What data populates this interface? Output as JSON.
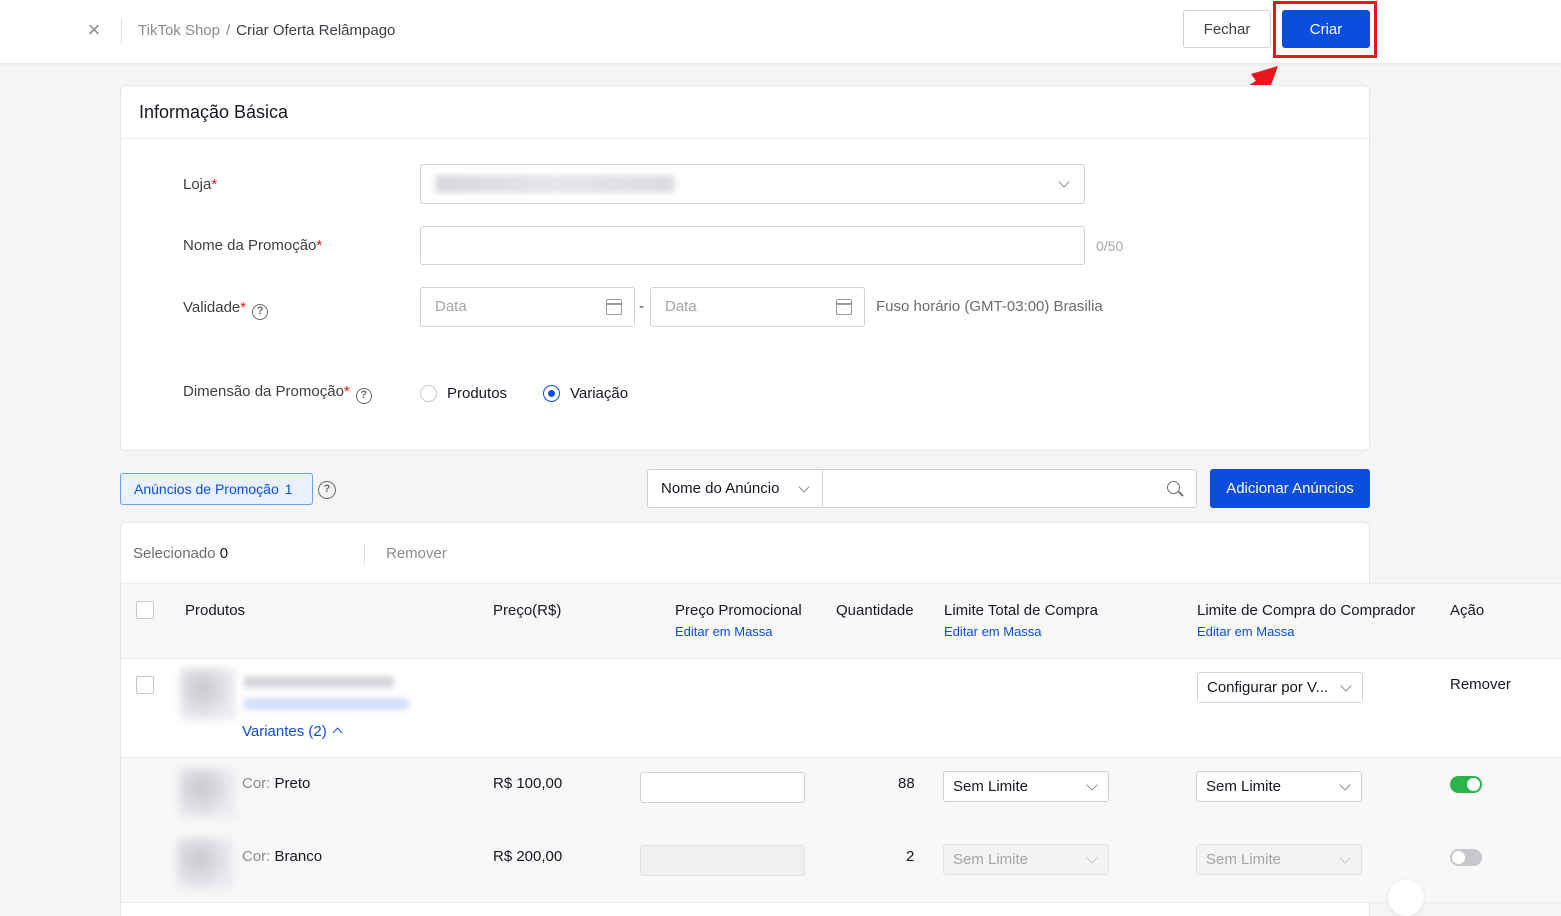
{
  "header": {
    "breadcrumb_root": "TikTok Shop",
    "breadcrumb_sep": "/",
    "breadcrumb_current": "Criar Oferta Relâmpago",
    "close_label": "Fechar",
    "create_label": "Criar"
  },
  "basic_info": {
    "title": "Informação Básica",
    "store_label": "Loja",
    "promo_name_label": "Nome da Promoção",
    "promo_name_counter": "0/50",
    "validity_label": "Validade",
    "date_start_placeholder": "Data",
    "date_sep": "-",
    "date_end_placeholder": "Data",
    "timezone": "Fuso horário (GMT-03:00) Brasilia",
    "dimension_label": "Dimensão da Promoção",
    "dimension_options": [
      "Produtos",
      "Variação"
    ],
    "dimension_selected": "Variação",
    "required_mark": "*",
    "help_mark": "?"
  },
  "listings": {
    "tab_label": "Anúncios de Promoção",
    "tab_count": "1",
    "search_field_select": "Nome do Anúncio",
    "add_button": "Adicionar Anúncios"
  },
  "table": {
    "selected_label": "Selecionado",
    "selected_count": "0",
    "remove_label": "Remover",
    "columns": {
      "products": "Produtos",
      "price": "Preço(R$)",
      "promo_price": "Preço Promocional",
      "promo_price_edit": "Editar em Massa",
      "quantity": "Quantidade",
      "total_limit": "Limite Total de Compra",
      "total_limit_edit": "Editar em Massa",
      "buyer_limit": "Limite de Compra do Comprador",
      "buyer_limit_edit": "Editar em Massa",
      "action": "Ação"
    },
    "product": {
      "variants_link": "Variantes (2)",
      "buyer_limit_select": "Configurar por V...",
      "action": "Remover"
    },
    "variants": [
      {
        "attr_key": "Cor:",
        "attr_value": "Preto",
        "price": "R$ 100,00",
        "quantity": "88",
        "total_limit": "Sem Limite",
        "buyer_limit": "Sem Limite",
        "enabled": true
      },
      {
        "attr_key": "Cor:",
        "attr_value": "Branco",
        "price": "R$ 200,00",
        "quantity": "2",
        "total_limit": "Sem Limite",
        "buyer_limit": "Sem Limite",
        "enabled": false
      }
    ]
  },
  "colors": {
    "primary": "#0b4ddf",
    "highlight": "#e8161d",
    "toggle_on": "#2bb44b"
  },
  "icons": [
    "close-icon",
    "chevron-down-icon",
    "calendar-icon",
    "help-icon",
    "search-icon",
    "chevron-up-icon",
    "arrow-annotation"
  ]
}
